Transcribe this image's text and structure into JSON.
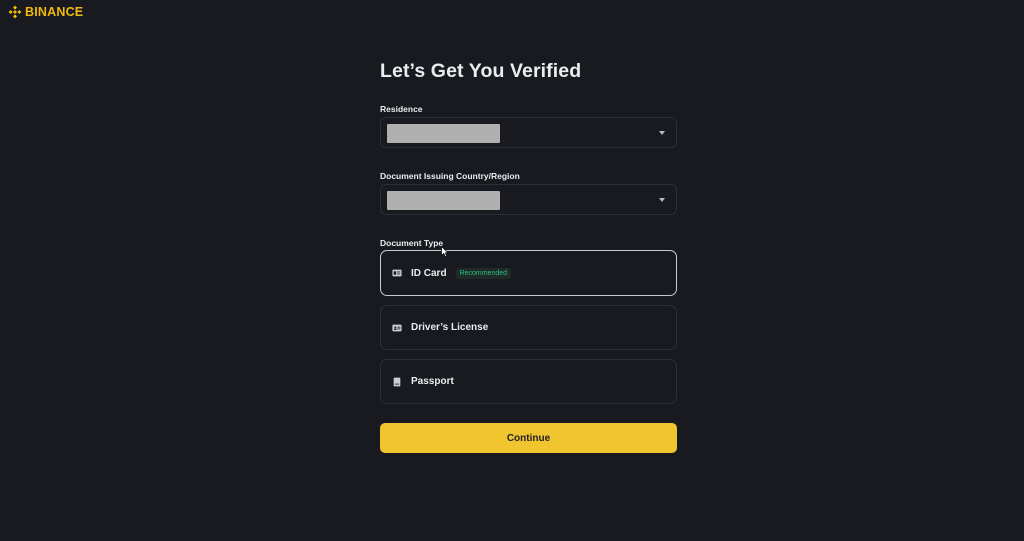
{
  "brand": {
    "name": "BINANCE",
    "color": "#f0b90b"
  },
  "page": {
    "title": "Let’s Get You Verified"
  },
  "residence": {
    "label": "Residence",
    "value": ""
  },
  "issuing": {
    "label": "Document Issuing Country/Region",
    "value": ""
  },
  "document_type": {
    "label": "Document Type",
    "options": [
      {
        "label": "ID Card",
        "icon": "id-card-icon",
        "badge": "Recommended",
        "selected": true
      },
      {
        "label": "Driver’s License",
        "icon": "drivers-license-icon",
        "selected": false
      },
      {
        "label": "Passport",
        "icon": "passport-icon",
        "selected": false
      }
    ]
  },
  "actions": {
    "continue_label": "Continue"
  },
  "colors": {
    "background": "#181a20",
    "accent": "#f0c52f",
    "badge_text": "#2ebd85"
  }
}
